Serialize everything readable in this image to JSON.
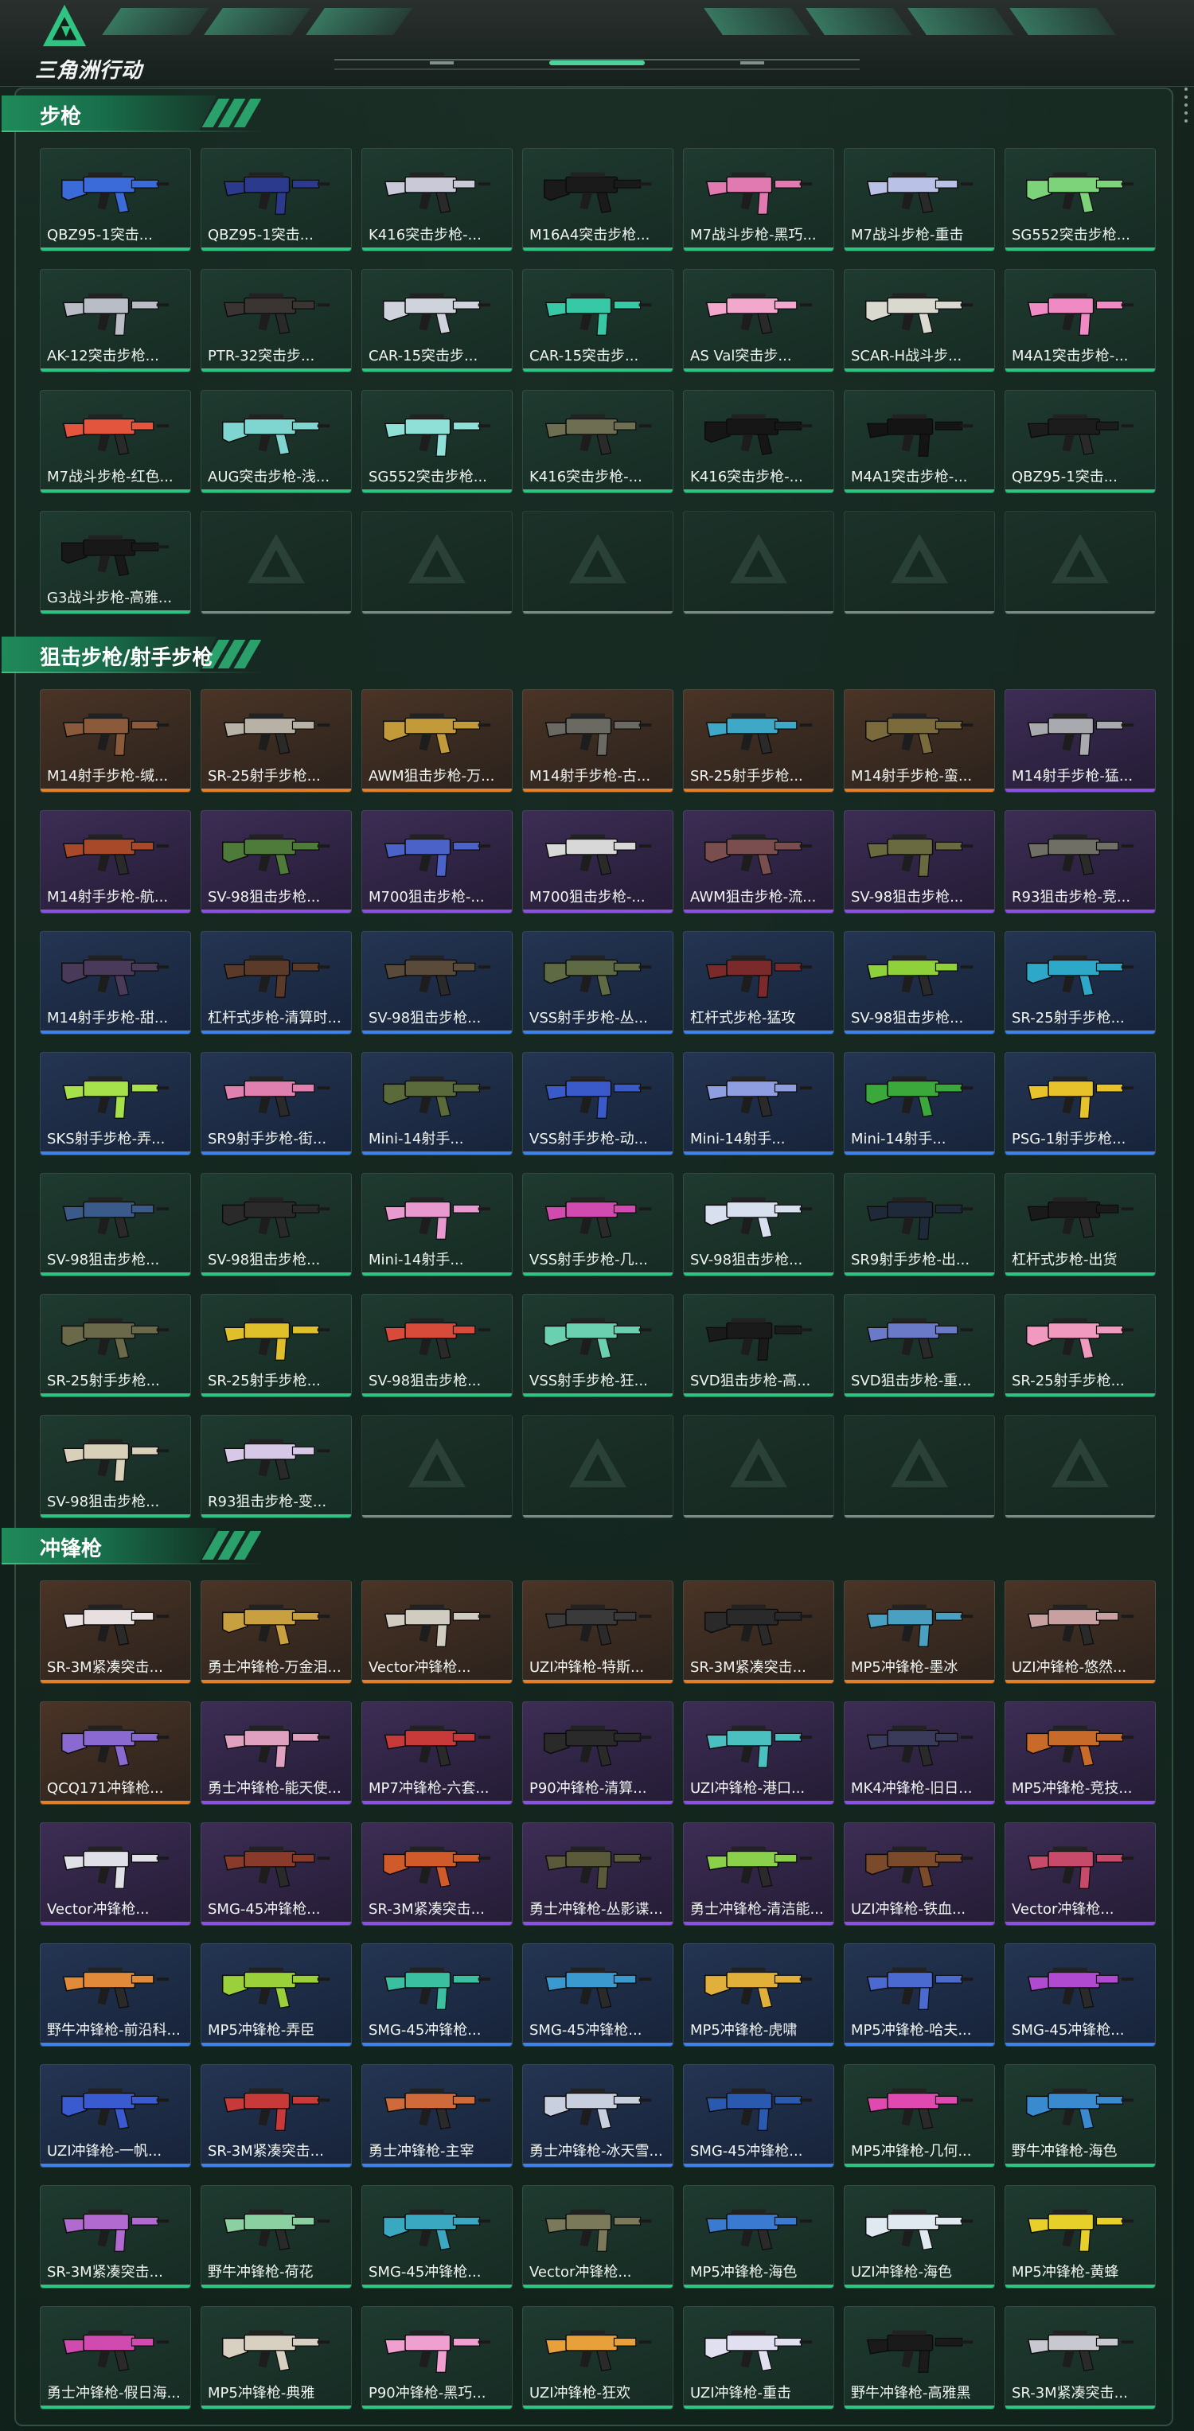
{
  "brand": {
    "logo_text": "三角洲行动",
    "logo_icon": "delta-triangle-icon"
  },
  "colors": {
    "accent": "#2fc482",
    "rarity_green": "#2fc482",
    "rarity_orange": "#e0802c",
    "rarity_purple": "#8a52e0",
    "rarity_blue": "#3f82e8"
  },
  "sections": [
    {
      "title": "步枪",
      "items": [
        {
          "name": "QBZ95-1突击...",
          "rarity": "green",
          "color": "#3a6bd8"
        },
        {
          "name": "QBZ95-1突击...",
          "rarity": "green",
          "color": "#2b3a8c"
        },
        {
          "name": "K416突击步枪-...",
          "rarity": "green",
          "color": "#c9c9d8"
        },
        {
          "name": "M16A4突击步枪...",
          "rarity": "green",
          "color": "#1a1a1a"
        },
        {
          "name": "M7战斗步枪-黑巧...",
          "rarity": "green",
          "color": "#e07ab0"
        },
        {
          "name": "M7战斗步枪-重击",
          "rarity": "green",
          "color": "#b9c2e6"
        },
        {
          "name": "SG552突击步枪...",
          "rarity": "green",
          "color": "#7dd37a"
        },
        {
          "name": "AK-12突击步枪...",
          "rarity": "green",
          "color": "#b9bec6"
        },
        {
          "name": "PTR-32突击步...",
          "rarity": "green",
          "color": "#3a3532"
        },
        {
          "name": "CAR-15突击步...",
          "rarity": "green",
          "color": "#cfd3dc"
        },
        {
          "name": "CAR-15突击步...",
          "rarity": "green",
          "color": "#37c9a6"
        },
        {
          "name": "AS Val突击步...",
          "rarity": "green",
          "color": "#f1a8cc"
        },
        {
          "name": "SCAR-H战斗步...",
          "rarity": "green",
          "color": "#d9d9d0"
        },
        {
          "name": "M4A1突击步枪-...",
          "rarity": "green",
          "color": "#f08ac4"
        },
        {
          "name": "M7战斗步枪-红色...",
          "rarity": "green",
          "color": "#e4553e"
        },
        {
          "name": "AUG突击步枪-浅...",
          "rarity": "green",
          "color": "#7fd6d0"
        },
        {
          "name": "SG552突击步枪...",
          "rarity": "green",
          "color": "#8fe0d6"
        },
        {
          "name": "K416突击步枪-...",
          "rarity": "green",
          "color": "#6e6e52"
        },
        {
          "name": "K416突击步枪-...",
          "rarity": "green",
          "color": "#161616"
        },
        {
          "name": "M4A1突击步枪-...",
          "rarity": "green",
          "color": "#141414"
        },
        {
          "name": "QBZ95-1突击...",
          "rarity": "green",
          "color": "#1c1c1c"
        },
        {
          "name": "G3战斗步枪-高雅...",
          "rarity": "green",
          "color": "#181818"
        }
      ],
      "empty_slots": 6
    },
    {
      "title": "狙击步枪/射手步枪",
      "items": [
        {
          "name": "M14射手步枪-缄...",
          "rarity": "orange",
          "color": "#8a5a3a"
        },
        {
          "name": "SR-25射手步枪...",
          "rarity": "orange",
          "color": "#b8b2a6"
        },
        {
          "name": "AWM狙击步枪-万...",
          "rarity": "orange",
          "color": "#c29a3a"
        },
        {
          "name": "M14射手步枪-古...",
          "rarity": "orange",
          "color": "#6a6a62"
        },
        {
          "name": "SR-25射手步枪...",
          "rarity": "orange",
          "color": "#3fa8c6"
        },
        {
          "name": "M14射手步枪-蛮...",
          "rarity": "orange",
          "color": "#7a6a3c"
        },
        {
          "name": "M14射手步枪-猛...",
          "rarity": "purple",
          "color": "#a9a9b0"
        },
        {
          "name": "M14射手步枪-航...",
          "rarity": "purple",
          "color": "#a84a2a"
        },
        {
          "name": "SV-98狙击步枪...",
          "rarity": "purple",
          "color": "#4e7a3a"
        },
        {
          "name": "M700狙击步枪-...",
          "rarity": "purple",
          "color": "#4b63c9"
        },
        {
          "name": "M700狙击步枪-...",
          "rarity": "purple",
          "color": "#d8d8d8"
        },
        {
          "name": "AWM狙击步枪-流...",
          "rarity": "purple",
          "color": "#7a4e4e"
        },
        {
          "name": "SV-98狙击步枪...",
          "rarity": "purple",
          "color": "#6a6a40"
        },
        {
          "name": "R93狙击步枪-竞...",
          "rarity": "purple",
          "color": "#6f6f66"
        },
        {
          "name": "M14射手步枪-甜...",
          "rarity": "blue",
          "color": "#4a3a5a"
        },
        {
          "name": "杠杆式步枪-清算时...",
          "rarity": "blue",
          "color": "#5c3a2a"
        },
        {
          "name": "SV-98狙击步枪...",
          "rarity": "blue",
          "color": "#5a4a3a"
        },
        {
          "name": "VSS射手步枪-丛...",
          "rarity": "blue",
          "color": "#5e6a44"
        },
        {
          "name": "杠杆式步枪-猛攻",
          "rarity": "blue",
          "color": "#7a2a2a"
        },
        {
          "name": "SV-98狙击步枪...",
          "rarity": "blue",
          "color": "#8ed13a"
        },
        {
          "name": "SR-25射手步枪...",
          "rarity": "blue",
          "color": "#2ea8c9"
        },
        {
          "name": "SKS射手步枪-弄...",
          "rarity": "blue",
          "color": "#a6e04a"
        },
        {
          "name": "SR9射手步枪-街...",
          "rarity": "blue",
          "color": "#e080b0"
        },
        {
          "name": "Mini-14射手...",
          "rarity": "blue",
          "color": "#5a6a3a"
        },
        {
          "name": "VSS射手步枪-动...",
          "rarity": "blue",
          "color": "#3a5ac9"
        },
        {
          "name": "Mini-14射手...",
          "rarity": "blue",
          "color": "#8e9ee0"
        },
        {
          "name": "Mini-14射手...",
          "rarity": "blue",
          "color": "#3aa83a"
        },
        {
          "name": "PSG-1射手步枪...",
          "rarity": "blue",
          "color": "#e8c22a"
        },
        {
          "name": "SV-98狙击步枪...",
          "rarity": "green",
          "color": "#3a5a8a"
        },
        {
          "name": "SV-98狙击步枪...",
          "rarity": "green",
          "color": "#2a2a2a"
        },
        {
          "name": "Mini-14射手...",
          "rarity": "green",
          "color": "#e89ad0"
        },
        {
          "name": "VSS射手步枪-几...",
          "rarity": "green",
          "color": "#d04ab0"
        },
        {
          "name": "SV-98狙击步枪...",
          "rarity": "green",
          "color": "#d8e0f0"
        },
        {
          "name": "SR9射手步枪-出...",
          "rarity": "green",
          "color": "#1e2a3a"
        },
        {
          "name": "杠杆式步枪-出货",
          "rarity": "green",
          "color": "#1a1a1a"
        },
        {
          "name": "SR-25射手步枪...",
          "rarity": "green",
          "color": "#6a6a4a"
        },
        {
          "name": "SR-25射手步枪...",
          "rarity": "green",
          "color": "#e0c02a"
        },
        {
          "name": "SV-98狙击步枪...",
          "rarity": "green",
          "color": "#d84a3a"
        },
        {
          "name": "VSS射手步枪-狂...",
          "rarity": "green",
          "color": "#6ad0b0"
        },
        {
          "name": "SVD狙击步枪-高...",
          "rarity": "green",
          "color": "#1a1a1a"
        },
        {
          "name": "SVD狙击步枪-重...",
          "rarity": "green",
          "color": "#6a7ac9"
        },
        {
          "name": "SR-25射手步枪...",
          "rarity": "green",
          "color": "#f09ac0"
        },
        {
          "name": "SV-98狙击步枪...",
          "rarity": "green",
          "color": "#d8d0b8"
        },
        {
          "name": "R93狙击步枪-变...",
          "rarity": "green",
          "color": "#d8c8e8"
        }
      ],
      "empty_slots": 5
    },
    {
      "title": "冲锋枪",
      "items": [
        {
          "name": "SR-3M紧凑突击...",
          "rarity": "orange",
          "color": "#e8e0e0"
        },
        {
          "name": "勇士冲锋枪-万金泪...",
          "rarity": "orange",
          "color": "#c8a040"
        },
        {
          "name": "Vector冲锋枪...",
          "rarity": "orange",
          "color": "#d0ccc0"
        },
        {
          "name": "UZI冲锋枪-特斯...",
          "rarity": "orange",
          "color": "#3a3a3a"
        },
        {
          "name": "SR-3M紧凑突击...",
          "rarity": "orange",
          "color": "#2a2a2a"
        },
        {
          "name": "MP5冲锋枪-墨冰",
          "rarity": "orange",
          "color": "#4aa0c0"
        },
        {
          "name": "UZI冲锋枪-悠然...",
          "rarity": "orange",
          "color": "#c8a0a0"
        },
        {
          "name": "QCQ171冲锋枪...",
          "rarity": "orange",
          "color": "#8a6ad0"
        },
        {
          "name": "勇士冲锋枪-能天使...",
          "rarity": "purple",
          "color": "#e0a0c0"
        },
        {
          "name": "MP7冲锋枪-六套...",
          "rarity": "purple",
          "color": "#c83a3a"
        },
        {
          "name": "P90冲锋枪-清算...",
          "rarity": "purple",
          "color": "#2a2a2a"
        },
        {
          "name": "UZI冲锋枪-港口...",
          "rarity": "purple",
          "color": "#4ac0c0"
        },
        {
          "name": "MK4冲锋枪-旧日...",
          "rarity": "purple",
          "color": "#3a3a5a"
        },
        {
          "name": "MP5冲锋枪-竞技...",
          "rarity": "purple",
          "color": "#c86a2a"
        },
        {
          "name": "Vector冲锋枪...",
          "rarity": "purple",
          "color": "#e0e0e8"
        },
        {
          "name": "SMG-45冲锋枪...",
          "rarity": "purple",
          "color": "#8a3a2a"
        },
        {
          "name": "SR-3M紧凑突击...",
          "rarity": "purple",
          "color": "#d05a2a"
        },
        {
          "name": "勇士冲锋枪-丛影谍...",
          "rarity": "purple",
          "color": "#5a5a3a"
        },
        {
          "name": "勇士冲锋枪-清洁能...",
          "rarity": "purple",
          "color": "#8ad04a"
        },
        {
          "name": "UZI冲锋枪-铁血...",
          "rarity": "purple",
          "color": "#7a4a2a"
        },
        {
          "name": "Vector冲锋枪...",
          "rarity": "purple",
          "color": "#c84a6a"
        },
        {
          "name": "野牛冲锋枪-前沿科...",
          "rarity": "blue",
          "color": "#e08a3a"
        },
        {
          "name": "MP5冲锋枪-弄臣",
          "rarity": "blue",
          "color": "#9ad03a"
        },
        {
          "name": "SMG-45冲锋枪...",
          "rarity": "blue",
          "color": "#3ac0a0"
        },
        {
          "name": "SMG-45冲锋枪...",
          "rarity": "blue",
          "color": "#3a9ad0"
        },
        {
          "name": "MP5冲锋枪-虎啸",
          "rarity": "blue",
          "color": "#e0b03a"
        },
        {
          "name": "MP5冲锋枪-哈夫...",
          "rarity": "blue",
          "color": "#4a6ad0"
        },
        {
          "name": "SMG-45冲锋枪...",
          "rarity": "blue",
          "color": "#b04ad0"
        },
        {
          "name": "UZI冲锋枪-一帆...",
          "rarity": "blue",
          "color": "#3a5ad0"
        },
        {
          "name": "SR-3M紧凑突击...",
          "rarity": "blue",
          "color": "#c83a3a"
        },
        {
          "name": "勇士冲锋枪-主宰",
          "rarity": "blue",
          "color": "#d06a3a"
        },
        {
          "name": "勇士冲锋枪-冰天雪...",
          "rarity": "blue",
          "color": "#c8d0e0"
        },
        {
          "name": "SMG-45冲锋枪...",
          "rarity": "blue",
          "color": "#2a5ab0"
        },
        {
          "name": "MP5冲锋枪-几何...",
          "rarity": "green",
          "color": "#e04ab0"
        },
        {
          "name": "野牛冲锋枪-海色",
          "rarity": "green",
          "color": "#3a8ad0"
        },
        {
          "name": "SR-3M紧凑突击...",
          "rarity": "green",
          "color": "#b06ad0"
        },
        {
          "name": "野牛冲锋枪-荷花",
          "rarity": "green",
          "color": "#8ad0a0"
        },
        {
          "name": "SMG-45冲锋枪...",
          "rarity": "green",
          "color": "#3aa8c0"
        },
        {
          "name": "Vector冲锋枪...",
          "rarity": "green",
          "color": "#7a7a5a"
        },
        {
          "name": "MP5冲锋枪-海色",
          "rarity": "green",
          "color": "#3a7ad0"
        },
        {
          "name": "UZI冲锋枪-海色",
          "rarity": "green",
          "color": "#e0e8f0"
        },
        {
          "name": "MP5冲锋枪-黄蜂",
          "rarity": "green",
          "color": "#e8d02a"
        },
        {
          "name": "勇士冲锋枪-假日海...",
          "rarity": "green",
          "color": "#d04ab0"
        },
        {
          "name": "MP5冲锋枪-典雅",
          "rarity": "green",
          "color": "#d8d0c0"
        },
        {
          "name": "P90冲锋枪-黑巧...",
          "rarity": "green",
          "color": "#f0a0d0"
        },
        {
          "name": "UZI冲锋枪-狂欢",
          "rarity": "green",
          "color": "#e8a03a"
        },
        {
          "name": "UZI冲锋枪-重击",
          "rarity": "green",
          "color": "#e0e0f0"
        },
        {
          "name": "野牛冲锋枪-高雅黑",
          "rarity": "green",
          "color": "#1a1a1a"
        },
        {
          "name": "SR-3M紧凑突击...",
          "rarity": "green",
          "color": "#c8c8d0"
        }
      ],
      "empty_slots": 0
    }
  ]
}
